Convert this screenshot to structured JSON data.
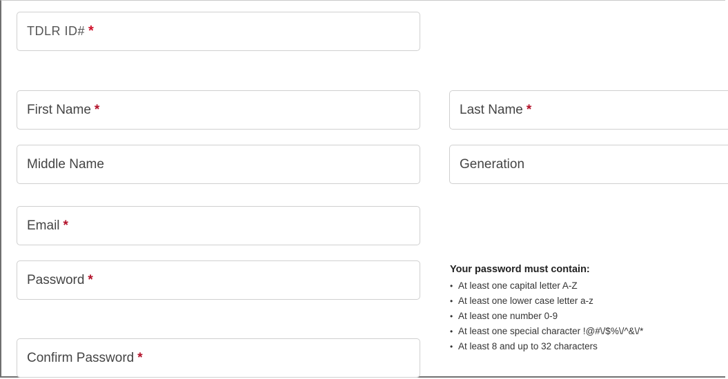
{
  "form": {
    "tdlr_id": {
      "label": "TDLR ID#",
      "required_mark": "*"
    },
    "first_name": {
      "label": "First Name",
      "required_mark": "*"
    },
    "last_name": {
      "label": "Last Name",
      "required_mark": "*"
    },
    "middle_name": {
      "label": "Middle Name"
    },
    "generation": {
      "label": "Generation"
    },
    "email": {
      "label": "Email",
      "required_mark": "*"
    },
    "password": {
      "label": "Password",
      "required_mark": "*"
    },
    "confirm_password": {
      "label": "Confirm Password",
      "required_mark": "*"
    }
  },
  "password_rules": {
    "heading": "Your password must contain:",
    "bullet": "•",
    "items": [
      "At least one capital letter A-Z",
      "At least one lower case letter a-z",
      "At least one number 0-9",
      "At least one special character !@#\\/$%\\/^&\\/*",
      "At least 8 and up to 32 characters"
    ]
  },
  "colors": {
    "required": "#b3122a",
    "field_border": "#cfcfcf"
  }
}
